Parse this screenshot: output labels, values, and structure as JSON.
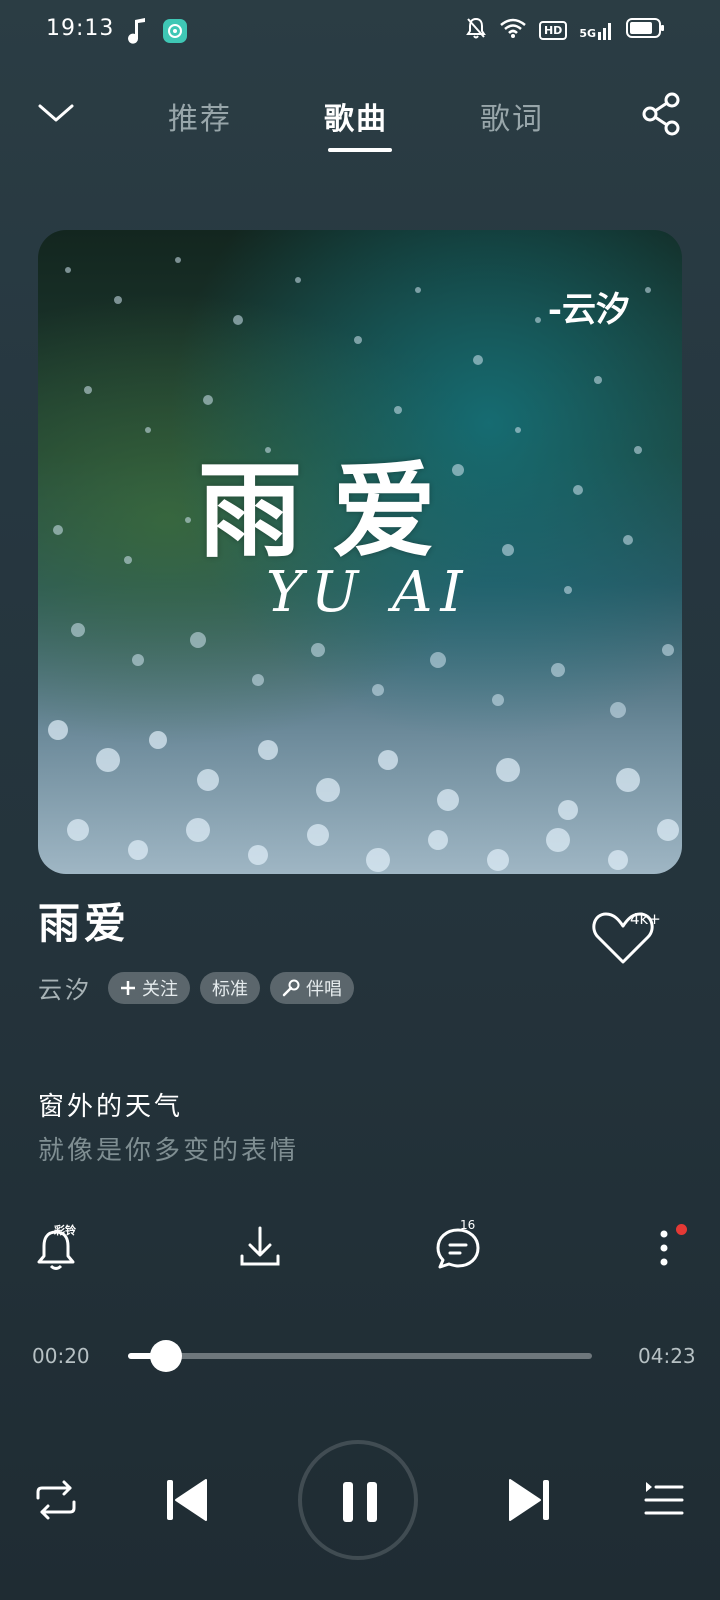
{
  "status_bar": {
    "time": "19:13",
    "icons": [
      "music-note-icon",
      "app-badge-icon",
      "mute-bell-icon",
      "wifi-icon",
      "hd-badge",
      "signal-5g-icon",
      "battery-icon"
    ],
    "hd_label": "HD",
    "network_label": "5G"
  },
  "nav": {
    "tabs": [
      {
        "label": "推荐",
        "active": false
      },
      {
        "label": "歌曲",
        "active": true
      },
      {
        "label": "歌词",
        "active": false
      }
    ]
  },
  "album_art": {
    "title_text": "雨爱",
    "subtitle_text": "YU AI",
    "author_text": "-云汐"
  },
  "song": {
    "title": "雨爱",
    "artist": "云汐",
    "like_count": "4k+",
    "tags": [
      {
        "label": "关注",
        "icon": "plus-icon"
      },
      {
        "label": "标准",
        "icon": ""
      },
      {
        "label": "伴唱",
        "icon": "microphone-icon"
      }
    ]
  },
  "lyrics": {
    "current": "窗外的天气",
    "next": "就像是你多变的表情"
  },
  "actions": {
    "ringtone_label": "彩铃",
    "comment_count": "16"
  },
  "progress": {
    "current_time": "00:20",
    "total_time": "04:23",
    "played_fraction": 0.076
  },
  "colors": {
    "background": "#263740",
    "accent": "#ffffff",
    "muted_text": "#7f8e92",
    "notify_dot": "#e53935"
  }
}
